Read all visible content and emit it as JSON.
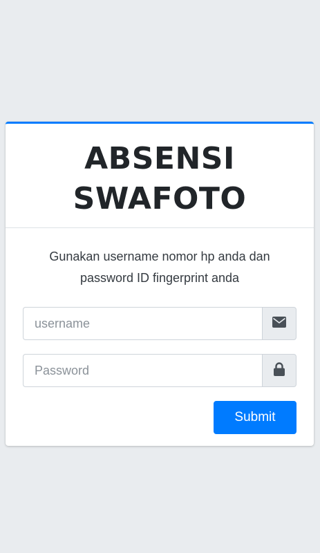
{
  "header": {
    "title_line1": "ABSENSI",
    "title_line2": "SWAFOTO"
  },
  "body": {
    "hint_line1": "Gunakan username nomor hp anda dan",
    "hint_line2": "password ID fingerprint anda"
  },
  "form": {
    "username": {
      "value": "",
      "placeholder": "username",
      "icon": "envelope-icon"
    },
    "password": {
      "value": "",
      "placeholder": "Password",
      "icon": "lock-icon"
    },
    "submit_label": "Submit"
  },
  "colors": {
    "accent": "#007bff",
    "page_background": "#e9ecef",
    "card_background": "#ffffff",
    "addon_background": "#e9ecef",
    "icon": "#495057",
    "title": "#212529"
  }
}
